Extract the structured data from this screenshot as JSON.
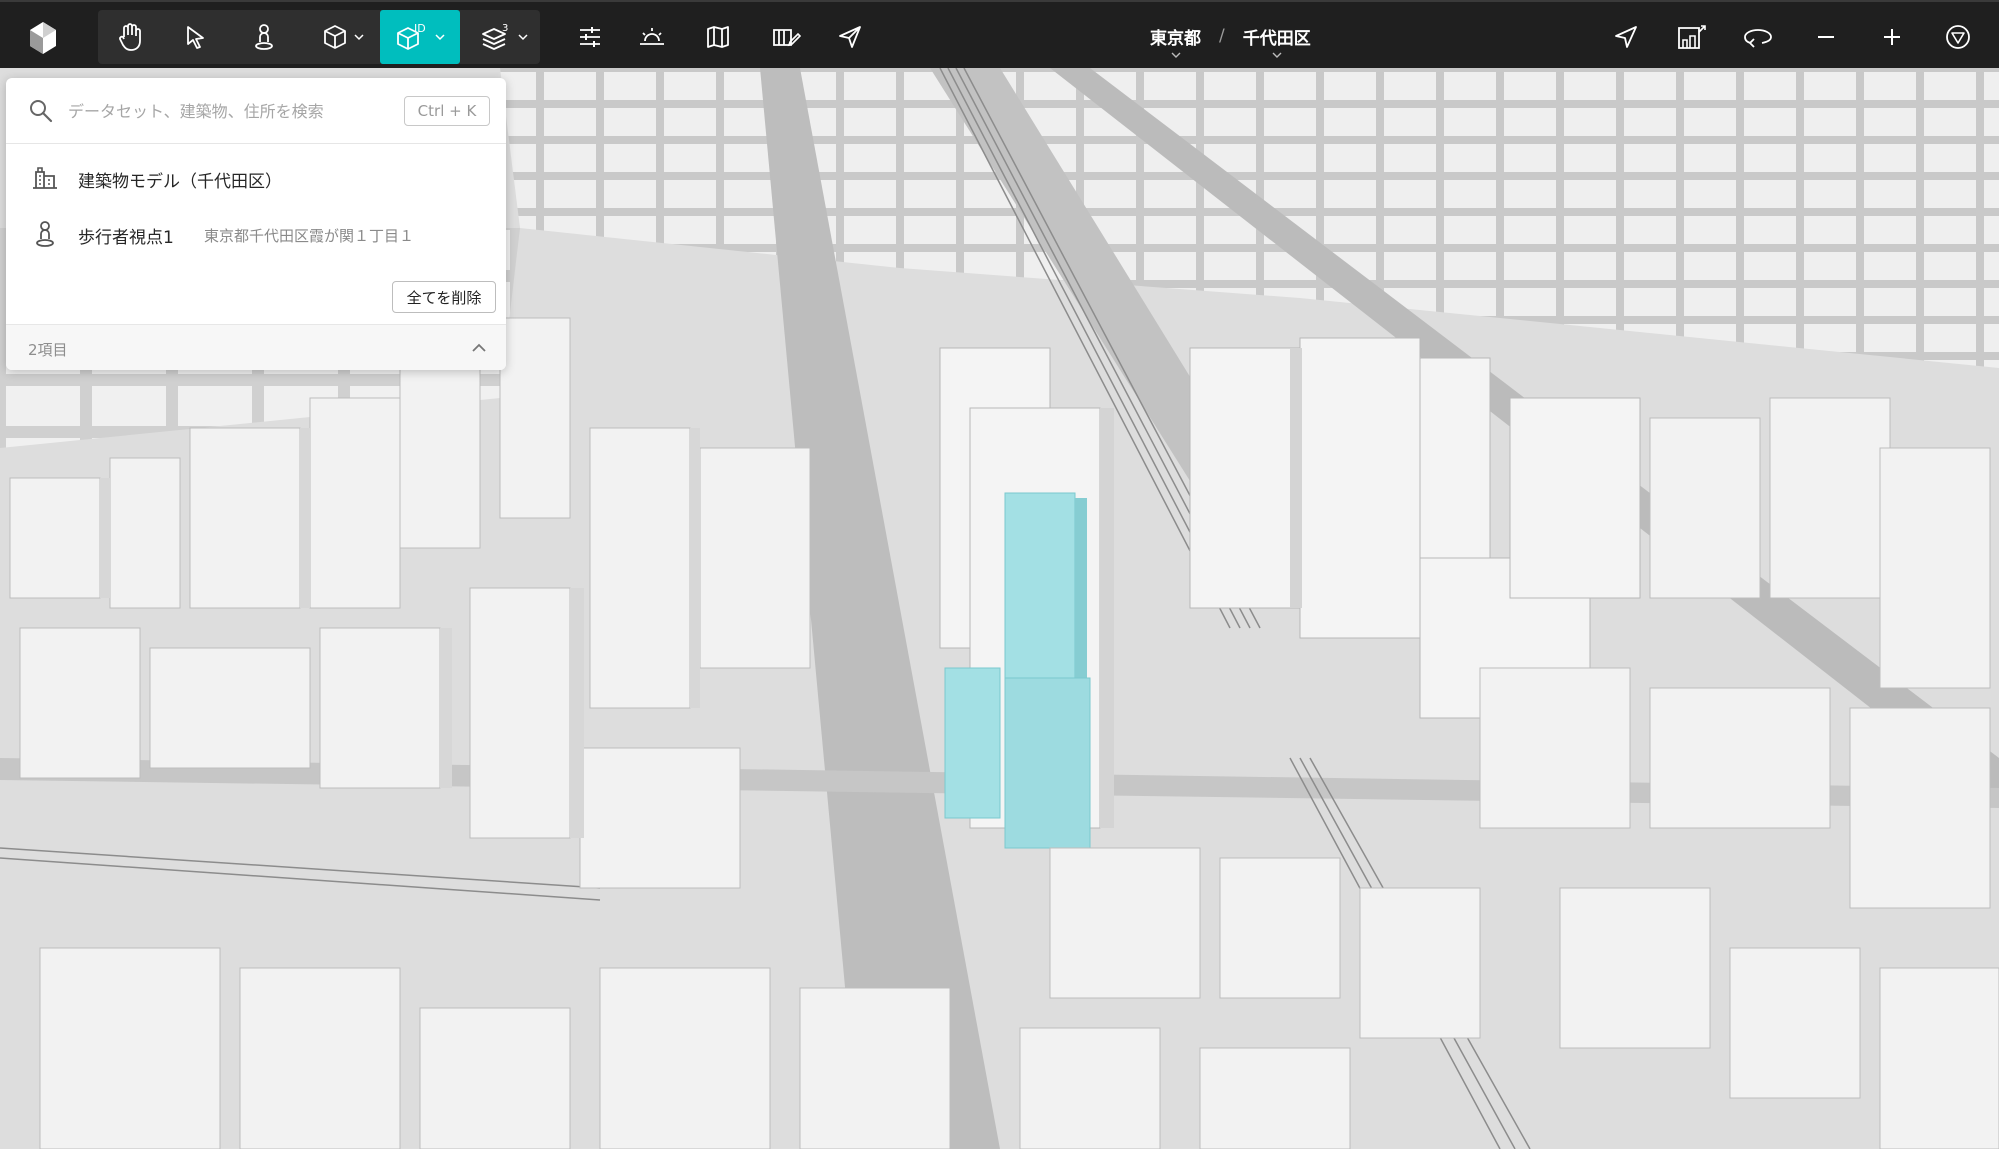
{
  "toolbar": {
    "tools": [
      {
        "icon": "hand-icon"
      },
      {
        "icon": "cursor-icon"
      },
      {
        "icon": "pedestrian-icon"
      },
      {
        "icon": "cube-icon"
      },
      {
        "icon": "building-id-icon",
        "badge": "ID"
      },
      {
        "icon": "layers-icon",
        "badge": "3"
      },
      {
        "icon": "sliders-icon"
      },
      {
        "icon": "sun-icon"
      },
      {
        "icon": "map-icon"
      },
      {
        "icon": "scene-edit-icon"
      },
      {
        "icon": "send-icon"
      }
    ],
    "right": [
      {
        "icon": "locate-icon"
      },
      {
        "icon": "street-view-icon"
      },
      {
        "icon": "rotate-icon"
      },
      {
        "icon": "zoom-out-icon"
      },
      {
        "icon": "zoom-in-icon"
      },
      {
        "icon": "compass-icon"
      }
    ]
  },
  "breadcrumb": {
    "prefecture": "東京都",
    "separator": "/",
    "ward": "千代田区"
  },
  "search": {
    "placeholder": "データセット、建築物、住所を検索",
    "shortcut": "Ctrl + K",
    "results": [
      {
        "icon": "building-model-icon",
        "label": "建築物モデル（千代田区）",
        "sub": ""
      },
      {
        "icon": "pedestrian-icon",
        "label": "歩行者視点1",
        "sub": "東京都千代田区霞が関１丁目１"
      }
    ],
    "clear_all_label": "全てを削除",
    "count_label": "2項目"
  },
  "colors": {
    "toolbar_bg": "#1f1f1f",
    "accent": "#00bebe",
    "highlight_building": "#9fdfe3",
    "map_base": "#dcdcdc"
  }
}
